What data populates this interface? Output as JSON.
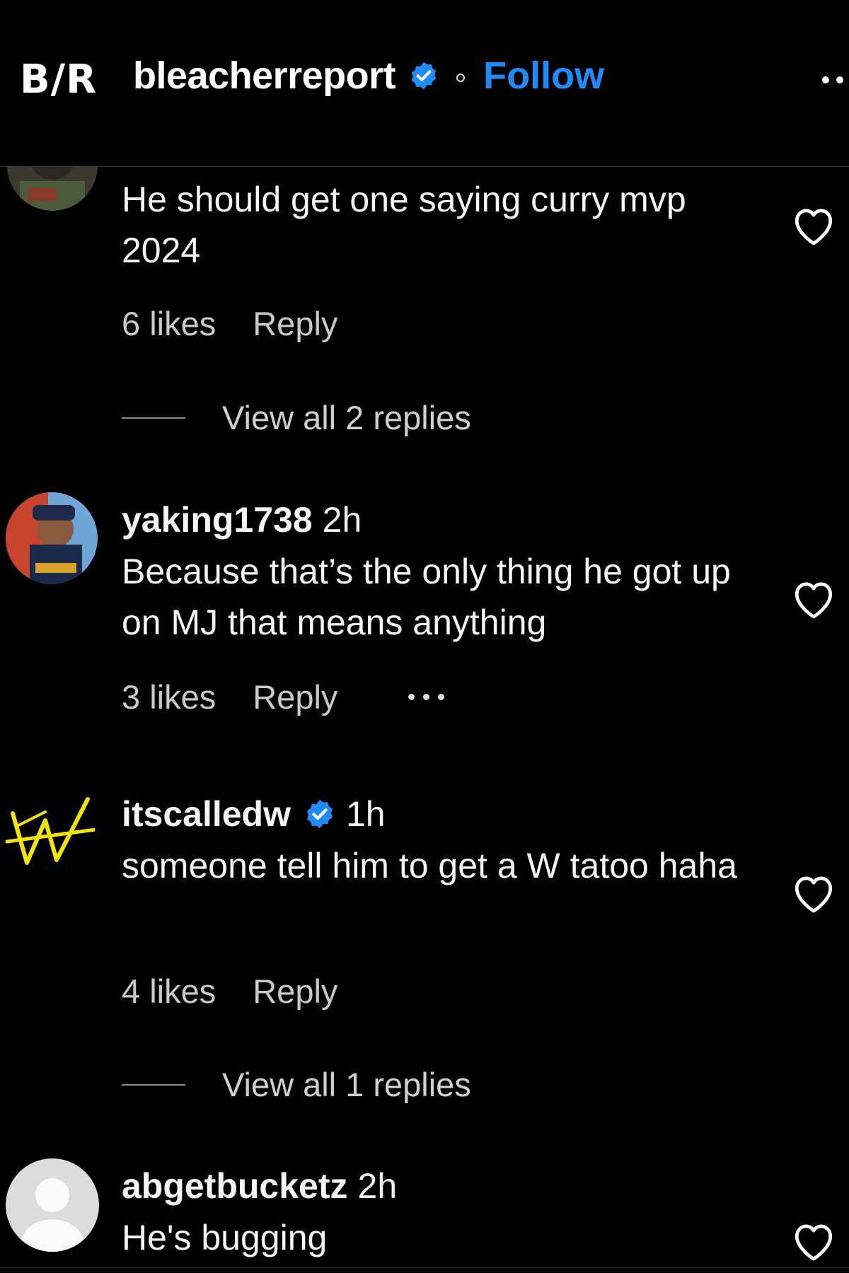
{
  "header": {
    "logo": "B/R",
    "account_name": "bleacherreport",
    "follow_label": "Follow"
  },
  "comments": [
    {
      "username": "",
      "time": "",
      "text": "He should get one saying curry mvp 2024",
      "likes": "6 likes",
      "reply_label": "Reply",
      "view_replies": "View all 2 replies"
    },
    {
      "username": "yaking1738",
      "time": "2h",
      "text": "Because that’s the only thing he got up on MJ that means anything",
      "likes": "3 likes",
      "reply_label": "Reply"
    },
    {
      "username": "itscalledw",
      "time": "1h",
      "text": "someone tell him to get a W tatoo haha",
      "likes": "4 likes",
      "reply_label": "Reply",
      "view_replies": "View all 1 replies"
    },
    {
      "username": "abgetbucketz",
      "time": "2h",
      "text": "He's bugging"
    }
  ],
  "colors": {
    "background": "#000000",
    "follow_blue": "#1d8cf8",
    "verified_blue": "#1d8cf8",
    "text": "#f5f5f5",
    "muted_text": "#c9c9c9",
    "w_logo_yellow": "#f2e600"
  },
  "icons": {
    "verified": "verified-badge-icon",
    "like": "heart-outline-icon",
    "more": "more-dots-icon"
  }
}
